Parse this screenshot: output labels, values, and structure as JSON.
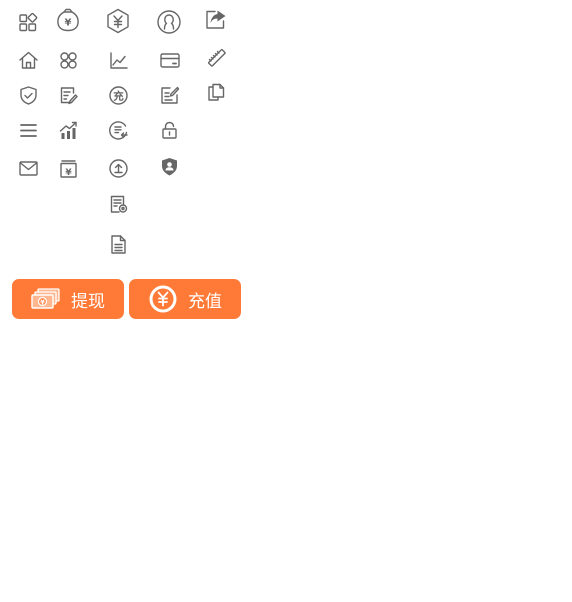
{
  "buttons": {
    "withdraw": {
      "label": "提现",
      "icon": "cash-stack-icon"
    },
    "recharge": {
      "label": "充值",
      "icon": "yen-coin-icon"
    }
  },
  "icon_glyphs": {
    "yen": "¥",
    "recharge_char": "充"
  },
  "colors": {
    "accent": "#ff7a37",
    "icon_gray": "#666666",
    "background": "#ffffff"
  }
}
